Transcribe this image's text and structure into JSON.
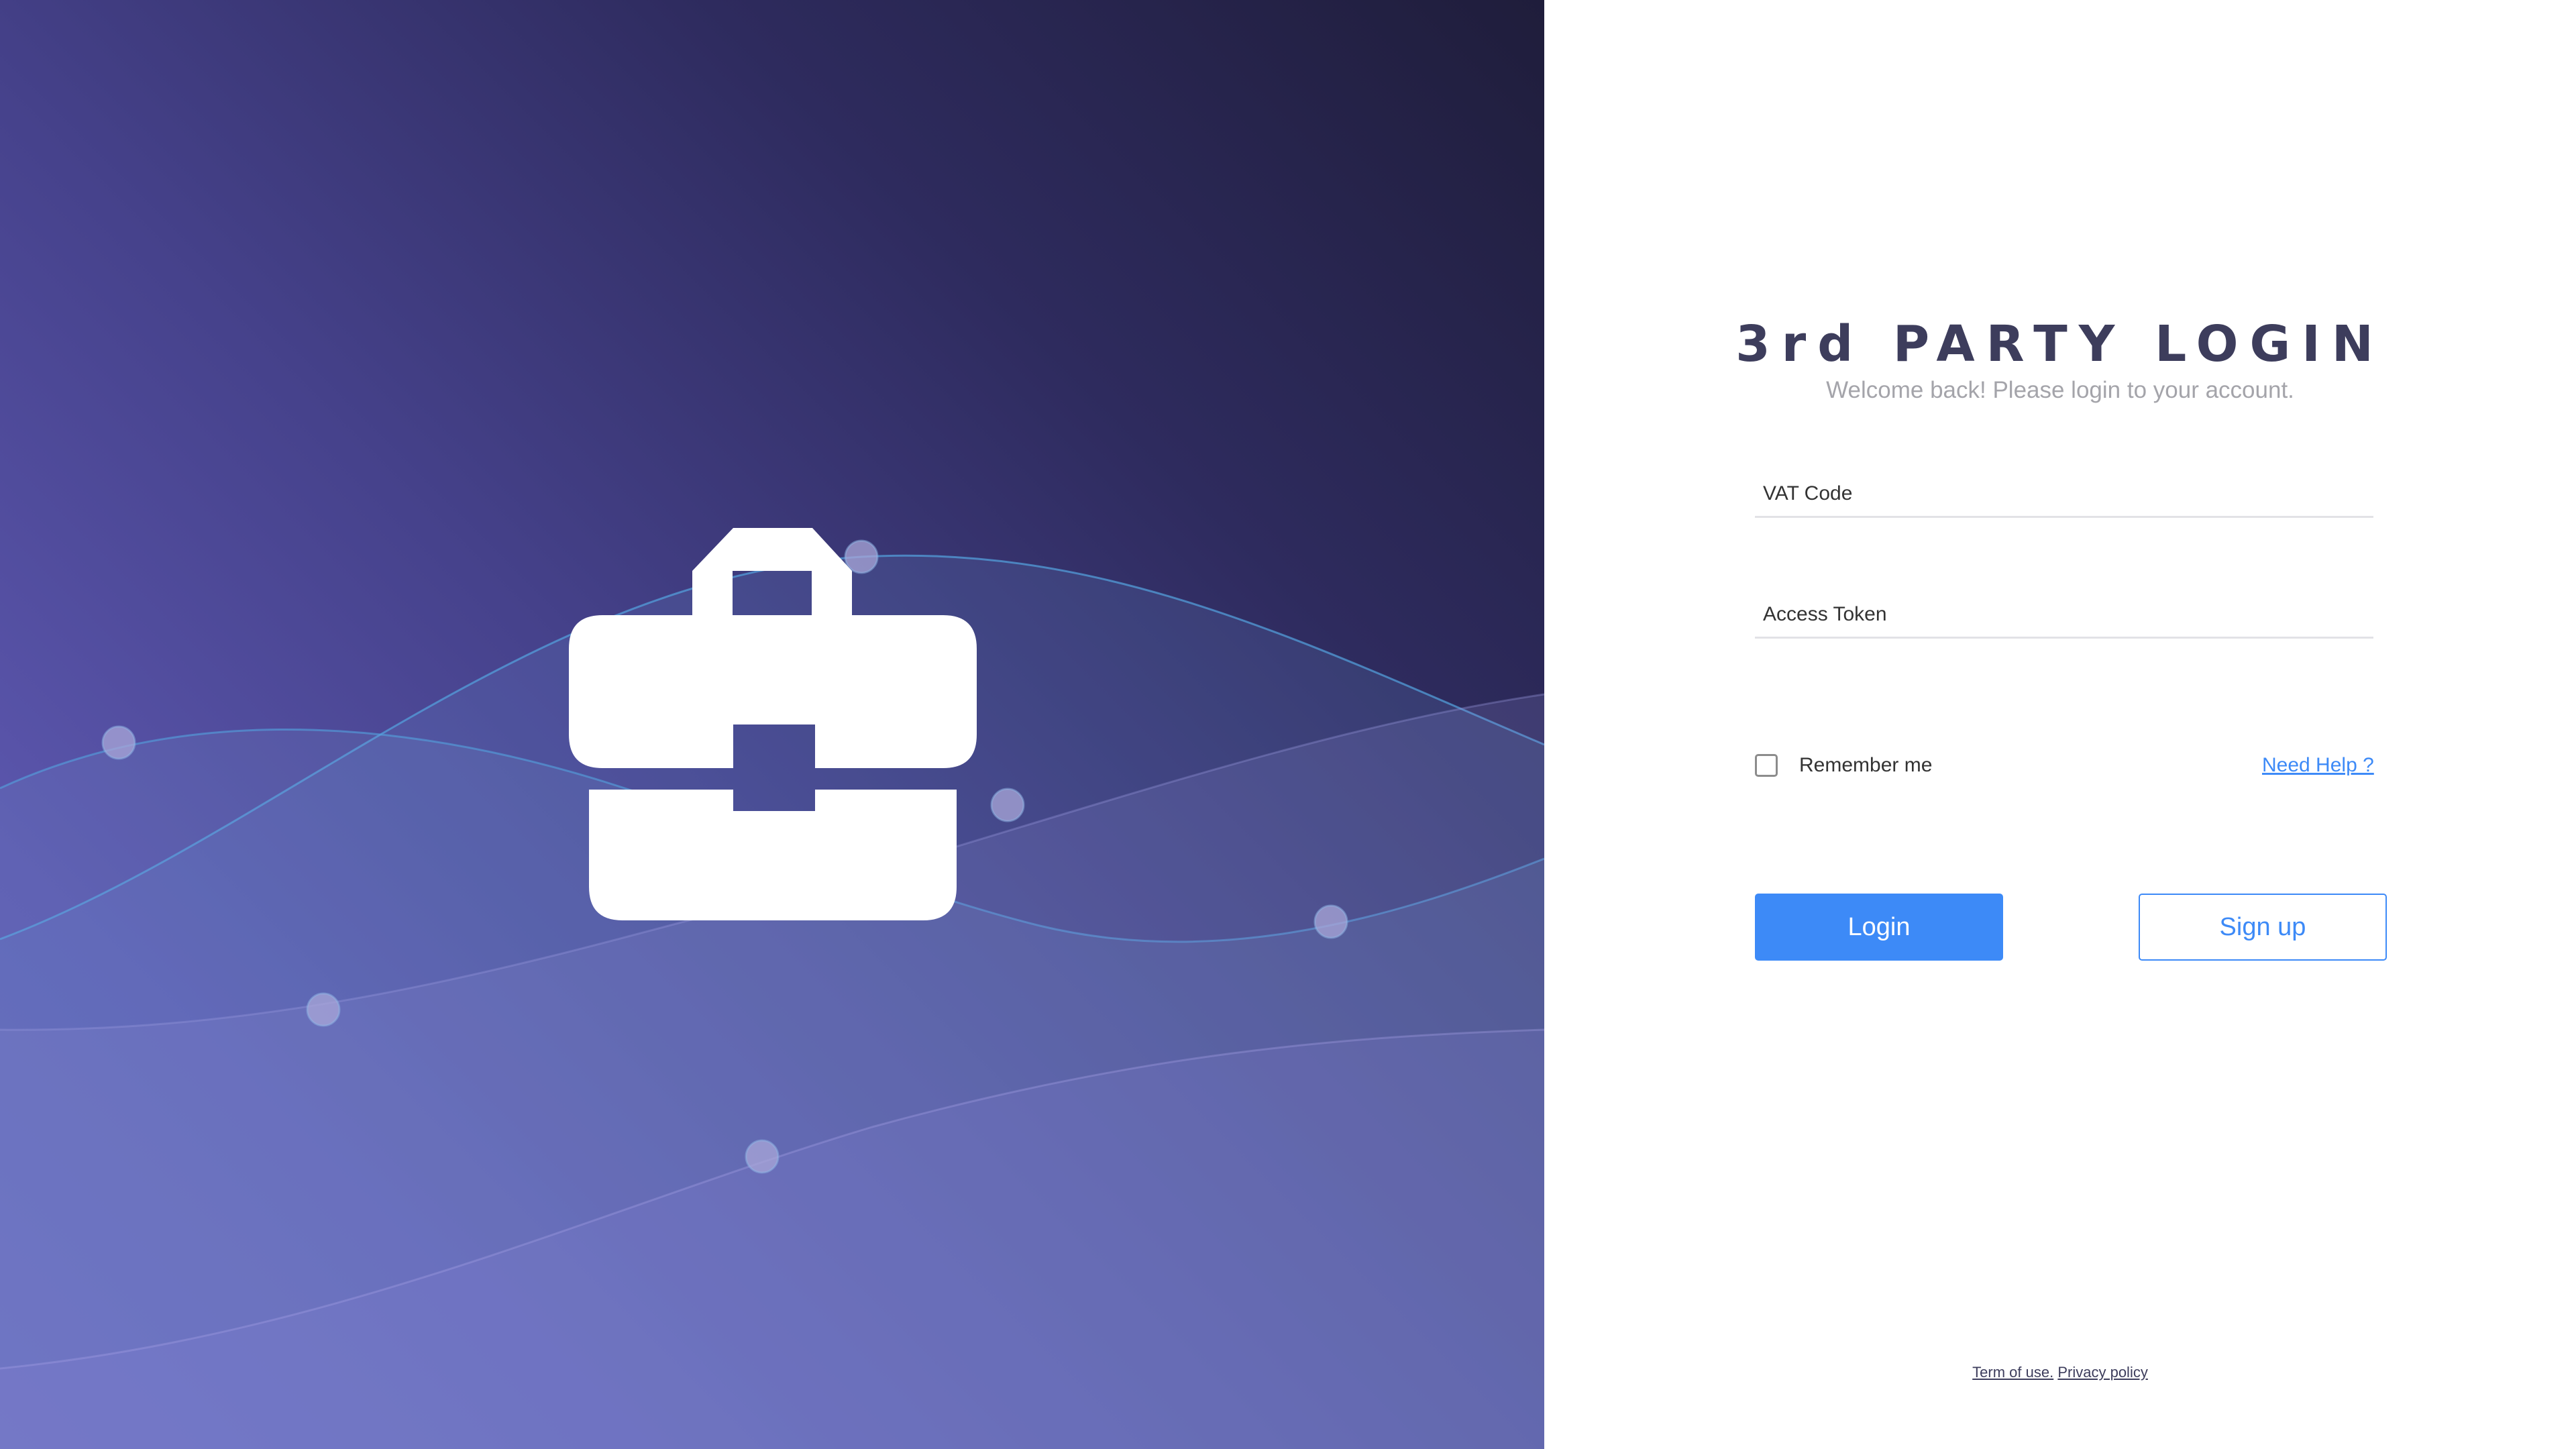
{
  "hero": {
    "icon": "briefcase-icon",
    "gradient_colors": [
      "#1f1d3b",
      "#46428c",
      "#6560b8"
    ]
  },
  "login": {
    "title": "3rd PARTY LOGIN",
    "subtitle": "Welcome back! Please login to your account.",
    "fields": {
      "vat_code": {
        "placeholder": "VAT Code",
        "value": ""
      },
      "access_token": {
        "placeholder": "Access Token",
        "value": ""
      }
    },
    "remember_me": {
      "label": "Remember me",
      "checked": false
    },
    "help_link": "Need Help ?",
    "buttons": {
      "login": "Login",
      "signup": "Sign up"
    },
    "footer": {
      "terms": "Term of use.",
      "privacy": "Privacy policy"
    }
  },
  "colors": {
    "accent": "#3d8af7",
    "title": "#3d3d5c",
    "subtitle": "#a4a4aa"
  }
}
